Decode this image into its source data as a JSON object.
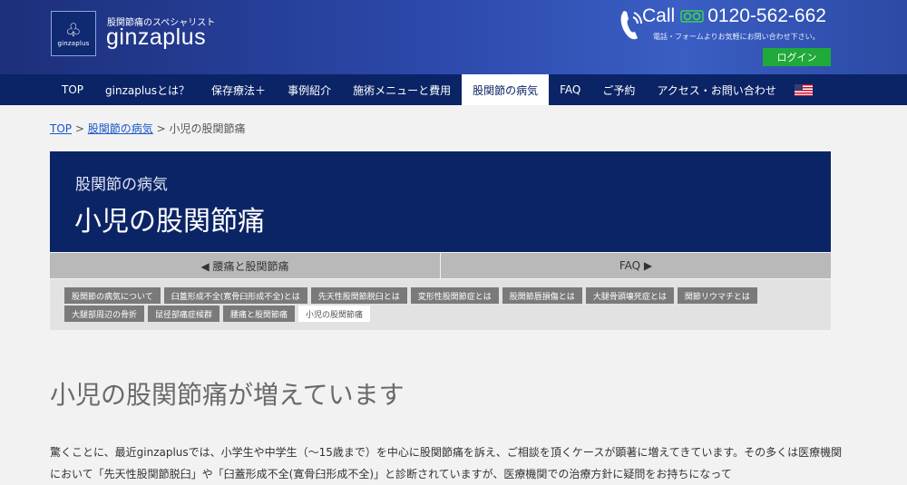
{
  "header": {
    "tagline": "股関節痛のスペシャリスト",
    "brand": "ginzaplus",
    "logo_text": "ginzaplus",
    "call_label": "Call",
    "phone": "0120-562-662",
    "phone_note": "電話・フォームよりお気軽にお問い合わせ下さい。",
    "login": "ログイン"
  },
  "nav": {
    "items": [
      "TOP",
      "ginzaplusとは？",
      "保存療法＋",
      "事例紹介",
      "施術メニューと費用",
      "股関節の病気",
      "FAQ",
      "ご予約",
      "アクセス・お問い合わせ"
    ],
    "active": "股関節の病気"
  },
  "breadcrumb": {
    "top": "TOP",
    "sep": ">",
    "parent": "股関節の病気",
    "current": "小児の股関節痛"
  },
  "title_panel": {
    "sub": "股関節の病気",
    "main": "小児の股関節痛"
  },
  "pager": {
    "prev": "◀ 腰痛と股関節痛",
    "next": "FAQ ▶"
  },
  "tags": [
    "股関節の病気について",
    "臼蓋形成不全(寛骨臼形成不全)とは",
    "先天性股関節脱臼とは",
    "変形性股関節症とは",
    "股関節唇損傷とは",
    "大腿骨頭壊死症とは",
    "関節リウマチとは",
    "大腿部周辺の骨折",
    "鼠径部痛症候群",
    "腰痛と股関節痛",
    "小児の股関節痛"
  ],
  "active_tag": "小児の股関節痛",
  "content": {
    "heading": "小児の股関節痛が増えています",
    "paragraph": "驚くことに、最近ginzaplusでは、小学生や中学生（〜15歳まで）を中心に股関節痛を訴え、ご相談を頂くケースが顕著に増えてきています。その多くは医療機関において「先天性股関節脱臼」や「臼蓋形成不全(寛骨臼形成不全)」と診断されていますが、医療機関での治療方針に疑問をお持ちになって"
  },
  "colors": {
    "nav_bg": "#0b2466",
    "login_bg": "#1faa3a",
    "link": "#1a57c8"
  }
}
